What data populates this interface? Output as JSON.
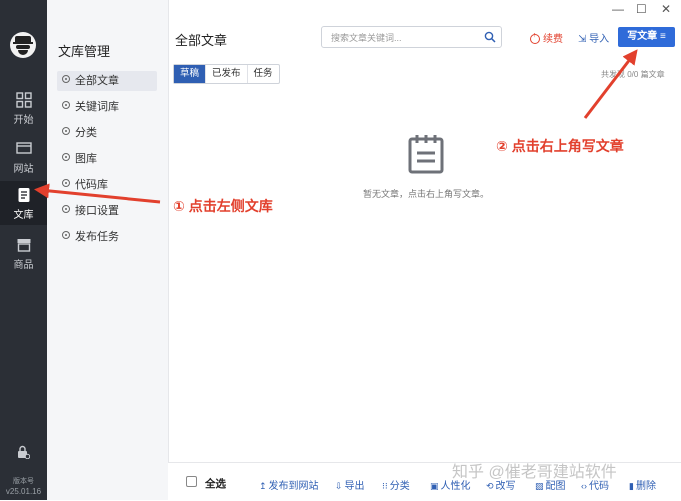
{
  "rail": {
    "items": [
      {
        "label": "开始",
        "icon": "grid-icon"
      },
      {
        "label": "网站",
        "icon": "monitor-icon"
      },
      {
        "label": "文库",
        "icon": "document-icon"
      },
      {
        "label": "商品",
        "icon": "store-icon"
      }
    ],
    "version_label": "版本号",
    "version": "v25.01.16"
  },
  "sidebar": {
    "title": "文库管理",
    "items": [
      {
        "label": "全部文章"
      },
      {
        "label": "关键词库"
      },
      {
        "label": "分类"
      },
      {
        "label": "图库"
      },
      {
        "label": "代码库"
      },
      {
        "label": "接口设置"
      },
      {
        "label": "发布任务"
      }
    ]
  },
  "header": {
    "title": "全部文章",
    "search_placeholder": "搜索文章关键词...",
    "renew_label": "续费",
    "import_label": "导入",
    "write_label": "写文章"
  },
  "window": {
    "minimize": "—",
    "maximize": "☐",
    "close": "✕"
  },
  "tabs": [
    {
      "label": "草稿"
    },
    {
      "label": "已发布"
    },
    {
      "label": "任务"
    }
  ],
  "found_text": "共发现 0/0 篇文章",
  "empty_text": "暂无文章，点击右上角写文章。",
  "bottom": {
    "select_all": "全选",
    "actions": [
      {
        "icon": "↥",
        "label": "发布到网站"
      },
      {
        "icon": "⇩",
        "label": "导出"
      },
      {
        "icon": "⁝⁝",
        "label": "分类"
      },
      {
        "icon": "▣",
        "label": "人性化"
      },
      {
        "icon": "⟲",
        "label": "改写"
      },
      {
        "icon": "▨",
        "label": "配图"
      },
      {
        "icon": "‹›",
        "label": "代码"
      },
      {
        "icon": "▮",
        "label": "删除"
      }
    ]
  },
  "annotations": {
    "left": "① 点击左侧文库",
    "right": "② 点击右上角写文章"
  },
  "watermark": "知乎 @催老哥建站软件",
  "colors": {
    "accent": "#2f6bd9",
    "annotation": "#e2402d",
    "rail": "#2b2f36"
  }
}
